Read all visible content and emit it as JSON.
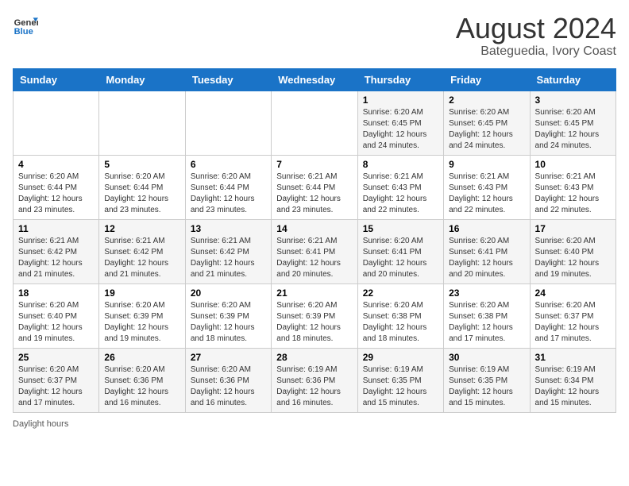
{
  "logo": {
    "line1": "General",
    "line2": "Blue"
  },
  "title": "August 2024",
  "subtitle": "Bateguedia, Ivory Coast",
  "days_of_week": [
    "Sunday",
    "Monday",
    "Tuesday",
    "Wednesday",
    "Thursday",
    "Friday",
    "Saturday"
  ],
  "weeks": [
    [
      {
        "day": "",
        "detail": ""
      },
      {
        "day": "",
        "detail": ""
      },
      {
        "day": "",
        "detail": ""
      },
      {
        "day": "",
        "detail": ""
      },
      {
        "day": "1",
        "detail": "Sunrise: 6:20 AM\nSunset: 6:45 PM\nDaylight: 12 hours and 24 minutes."
      },
      {
        "day": "2",
        "detail": "Sunrise: 6:20 AM\nSunset: 6:45 PM\nDaylight: 12 hours and 24 minutes."
      },
      {
        "day": "3",
        "detail": "Sunrise: 6:20 AM\nSunset: 6:45 PM\nDaylight: 12 hours and 24 minutes."
      }
    ],
    [
      {
        "day": "4",
        "detail": "Sunrise: 6:20 AM\nSunset: 6:44 PM\nDaylight: 12 hours and 23 minutes."
      },
      {
        "day": "5",
        "detail": "Sunrise: 6:20 AM\nSunset: 6:44 PM\nDaylight: 12 hours and 23 minutes."
      },
      {
        "day": "6",
        "detail": "Sunrise: 6:20 AM\nSunset: 6:44 PM\nDaylight: 12 hours and 23 minutes."
      },
      {
        "day": "7",
        "detail": "Sunrise: 6:21 AM\nSunset: 6:44 PM\nDaylight: 12 hours and 23 minutes."
      },
      {
        "day": "8",
        "detail": "Sunrise: 6:21 AM\nSunset: 6:43 PM\nDaylight: 12 hours and 22 minutes."
      },
      {
        "day": "9",
        "detail": "Sunrise: 6:21 AM\nSunset: 6:43 PM\nDaylight: 12 hours and 22 minutes."
      },
      {
        "day": "10",
        "detail": "Sunrise: 6:21 AM\nSunset: 6:43 PM\nDaylight: 12 hours and 22 minutes."
      }
    ],
    [
      {
        "day": "11",
        "detail": "Sunrise: 6:21 AM\nSunset: 6:42 PM\nDaylight: 12 hours and 21 minutes."
      },
      {
        "day": "12",
        "detail": "Sunrise: 6:21 AM\nSunset: 6:42 PM\nDaylight: 12 hours and 21 minutes."
      },
      {
        "day": "13",
        "detail": "Sunrise: 6:21 AM\nSunset: 6:42 PM\nDaylight: 12 hours and 21 minutes."
      },
      {
        "day": "14",
        "detail": "Sunrise: 6:21 AM\nSunset: 6:41 PM\nDaylight: 12 hours and 20 minutes."
      },
      {
        "day": "15",
        "detail": "Sunrise: 6:20 AM\nSunset: 6:41 PM\nDaylight: 12 hours and 20 minutes."
      },
      {
        "day": "16",
        "detail": "Sunrise: 6:20 AM\nSunset: 6:41 PM\nDaylight: 12 hours and 20 minutes."
      },
      {
        "day": "17",
        "detail": "Sunrise: 6:20 AM\nSunset: 6:40 PM\nDaylight: 12 hours and 19 minutes."
      }
    ],
    [
      {
        "day": "18",
        "detail": "Sunrise: 6:20 AM\nSunset: 6:40 PM\nDaylight: 12 hours and 19 minutes."
      },
      {
        "day": "19",
        "detail": "Sunrise: 6:20 AM\nSunset: 6:39 PM\nDaylight: 12 hours and 19 minutes."
      },
      {
        "day": "20",
        "detail": "Sunrise: 6:20 AM\nSunset: 6:39 PM\nDaylight: 12 hours and 18 minutes."
      },
      {
        "day": "21",
        "detail": "Sunrise: 6:20 AM\nSunset: 6:39 PM\nDaylight: 12 hours and 18 minutes."
      },
      {
        "day": "22",
        "detail": "Sunrise: 6:20 AM\nSunset: 6:38 PM\nDaylight: 12 hours and 18 minutes."
      },
      {
        "day": "23",
        "detail": "Sunrise: 6:20 AM\nSunset: 6:38 PM\nDaylight: 12 hours and 17 minutes."
      },
      {
        "day": "24",
        "detail": "Sunrise: 6:20 AM\nSunset: 6:37 PM\nDaylight: 12 hours and 17 minutes."
      }
    ],
    [
      {
        "day": "25",
        "detail": "Sunrise: 6:20 AM\nSunset: 6:37 PM\nDaylight: 12 hours and 17 minutes."
      },
      {
        "day": "26",
        "detail": "Sunrise: 6:20 AM\nSunset: 6:36 PM\nDaylight: 12 hours and 16 minutes."
      },
      {
        "day": "27",
        "detail": "Sunrise: 6:20 AM\nSunset: 6:36 PM\nDaylight: 12 hours and 16 minutes."
      },
      {
        "day": "28",
        "detail": "Sunrise: 6:19 AM\nSunset: 6:36 PM\nDaylight: 12 hours and 16 minutes."
      },
      {
        "day": "29",
        "detail": "Sunrise: 6:19 AM\nSunset: 6:35 PM\nDaylight: 12 hours and 15 minutes."
      },
      {
        "day": "30",
        "detail": "Sunrise: 6:19 AM\nSunset: 6:35 PM\nDaylight: 12 hours and 15 minutes."
      },
      {
        "day": "31",
        "detail": "Sunrise: 6:19 AM\nSunset: 6:34 PM\nDaylight: 12 hours and 15 minutes."
      }
    ]
  ],
  "footer": {
    "daylight_label": "Daylight hours"
  }
}
